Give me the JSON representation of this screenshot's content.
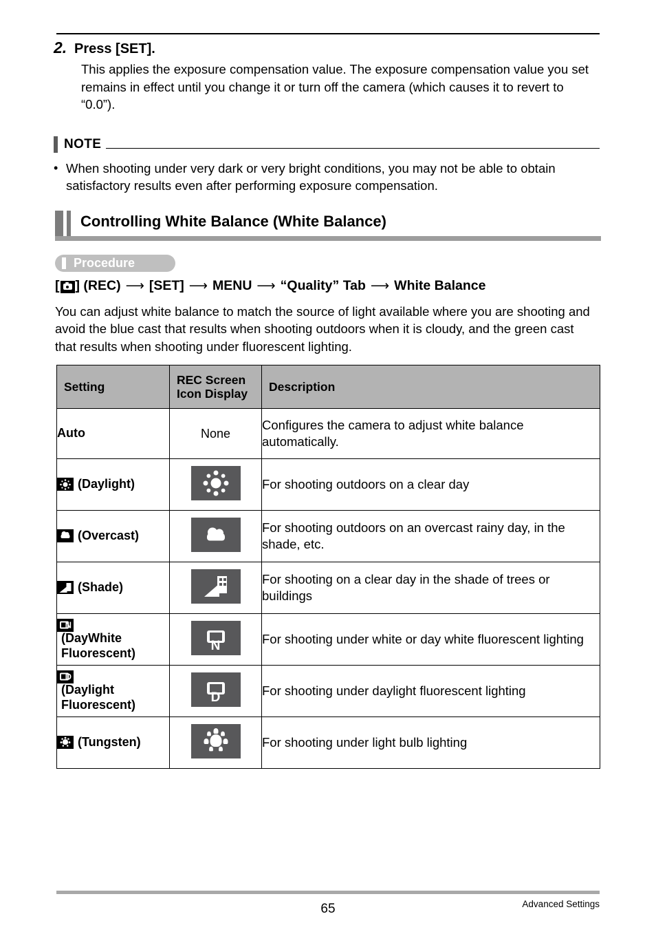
{
  "step": {
    "number": "2.",
    "title": "Press [SET].",
    "body": "This applies the exposure compensation value. The exposure compensation value you set remains in effect until you change it or turn off the camera (which causes it to revert to “0.0”)."
  },
  "note": {
    "label": "NOTE",
    "bullet": "•",
    "items": [
      "When shooting under very dark or very bright conditions, you may not be able to obtain satisfactory results even after performing exposure compensation."
    ]
  },
  "section": {
    "heading": "Controlling White Balance (White Balance)"
  },
  "procedure": {
    "label": "Procedure",
    "breadcrumb": {
      "rec_label": "] (REC)",
      "open_bracket": "[",
      "arrow": "⟶",
      "steps": [
        "[SET]",
        "MENU",
        "“Quality” Tab",
        "White Balance"
      ]
    }
  },
  "intro": "You can adjust white balance to match the source of light available where you are shooting and avoid the blue cast that results when shooting outdoors when it is cloudy, and the green cast that results when shooting under fluorescent lighting.",
  "table": {
    "headers": [
      "Setting",
      "REC Screen\nIcon Display",
      "Description"
    ],
    "header_setting": "Setting",
    "header_icon_line1": "REC Screen",
    "header_icon_line2": "Icon Display",
    "header_description": "Description",
    "rows": [
      {
        "setting": "Auto",
        "setting_icon": "none",
        "rec_icon": "none",
        "rec_icon_text": "None",
        "description": "Configures the camera to adjust white balance automatically."
      },
      {
        "setting": "(Daylight)",
        "setting_icon": "sun-icon",
        "rec_icon": "sun-icon",
        "rec_icon_text": "",
        "description": "For shooting outdoors on a clear day"
      },
      {
        "setting": "(Overcast)",
        "setting_icon": "cloud-icon",
        "rec_icon": "cloud-icon",
        "rec_icon_text": "",
        "description": "For shooting outdoors on an overcast rainy day, in the shade, etc."
      },
      {
        "setting": "(Shade)",
        "setting_icon": "shade-building-icon",
        "rec_icon": "shade-building-icon",
        "rec_icon_text": "",
        "description": "For shooting on a clear day in the shade of trees or buildings"
      },
      {
        "setting": "(DayWhite Fluorescent)",
        "setting_icon": "fluorescent-n-icon",
        "rec_icon": "fluorescent-n-icon",
        "rec_icon_text": "N",
        "description": "For shooting under white or day white fluorescent lighting"
      },
      {
        "setting": "(Daylight Fluorescent)",
        "setting_icon": "fluorescent-d-icon",
        "rec_icon": "fluorescent-d-icon",
        "rec_icon_text": "D",
        "description": "For shooting under daylight fluorescent lighting"
      },
      {
        "setting": "(Tungsten)",
        "setting_icon": "bulb-icon",
        "rec_icon": "bulb-icon",
        "rec_icon_text": "",
        "description": "For shooting under light bulb lighting"
      }
    ]
  },
  "footer": {
    "page_number": "65",
    "section_name": "Advanced Settings"
  },
  "colors": {
    "header_gray": "#b3b3b3",
    "rec_icon_gray": "#58585a",
    "heading_bar_gray": "#7c7c7c",
    "heading_rule_gray": "#9d9d9d",
    "badge_gray": "#bfbfbf",
    "footer_rule_gray": "#a8a8a8",
    "note_bar_gray": "#5b5b5b"
  }
}
